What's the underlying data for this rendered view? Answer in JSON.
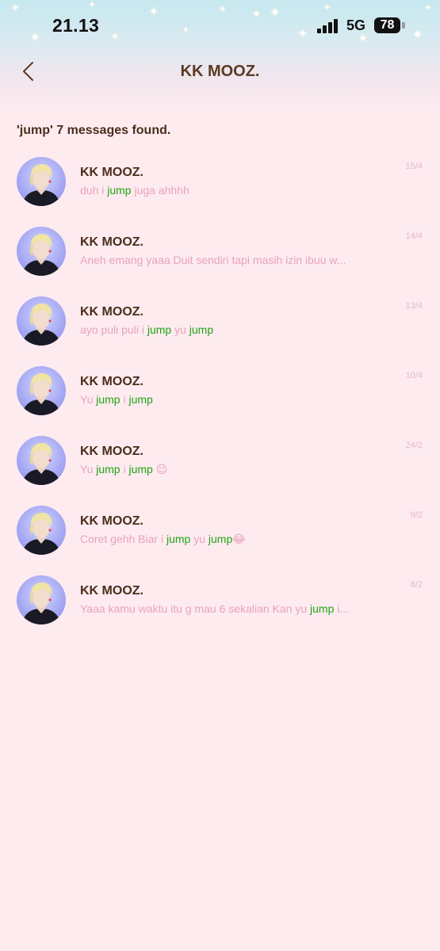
{
  "status_bar": {
    "time": "21.13",
    "network": "5G",
    "battery": "78"
  },
  "header": {
    "title": "KK MOOZ."
  },
  "search": {
    "summary": "'jump' 7 messages found."
  },
  "colors": {
    "background": "#fdebf0",
    "title_text": "#5a3a22",
    "preview_text": "#e9a3b8",
    "highlight": "#22a312",
    "date_text": "#e7b7c5"
  },
  "results": [
    {
      "name": "KK MOOZ.",
      "date": "15/4",
      "preview": [
        {
          "t": "duh i "
        },
        {
          "t": "jump",
          "hl": true
        },
        {
          "t": " juga ahhhh"
        }
      ]
    },
    {
      "name": "KK MOOZ.",
      "date": "14/4",
      "preview": [
        {
          "t": "Aneh emang yaaa Duit sendiri tapi masih izin ibuu w..."
        }
      ]
    },
    {
      "name": "KK MOOZ.",
      "date": "13/4",
      "preview": [
        {
          "t": "ayo puli puli i "
        },
        {
          "t": "jump",
          "hl": true
        },
        {
          "t": " yu "
        },
        {
          "t": "jump",
          "hl": true
        }
      ]
    },
    {
      "name": "KK MOOZ.",
      "date": "10/4",
      "preview": [
        {
          "t": "Yu "
        },
        {
          "t": "jump",
          "hl": true
        },
        {
          "t": " i "
        },
        {
          "t": "jump",
          "hl": true
        }
      ]
    },
    {
      "name": "KK MOOZ.",
      "date": "24/2",
      "preview": [
        {
          "t": "Yu "
        },
        {
          "t": "jump",
          "hl": true
        },
        {
          "t": " i "
        },
        {
          "t": "jump",
          "hl": true
        },
        {
          "t": " 😌"
        }
      ]
    },
    {
      "name": "KK MOOZ.",
      "date": "9/2",
      "preview": [
        {
          "t": "Coret gehh Biar i "
        },
        {
          "t": "jump",
          "hl": true
        },
        {
          "t": " yu "
        },
        {
          "t": "jump",
          "hl": true
        },
        {
          "t": "😂"
        }
      ]
    },
    {
      "name": "KK MOOZ.",
      "date": "8/2",
      "preview": [
        {
          "t": "Yaaa kamu waktu itu g mau 6 sekalian Kan yu "
        },
        {
          "t": "jump",
          "hl": true
        },
        {
          "t": " i..."
        }
      ]
    }
  ]
}
